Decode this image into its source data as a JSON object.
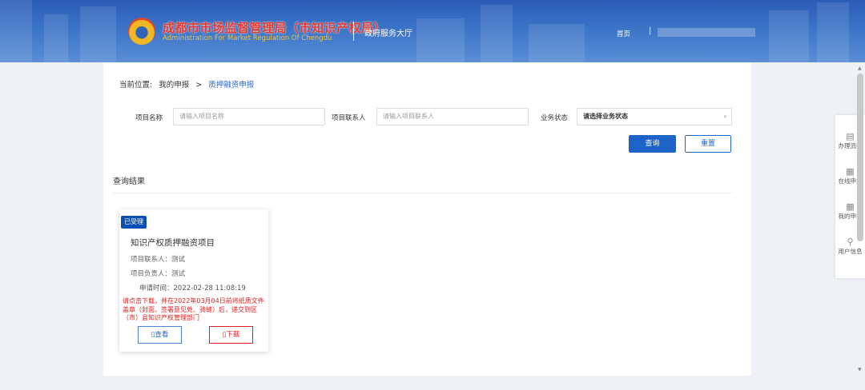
{
  "header": {
    "org_name_cn": "成都市市场监督管理局（市知识产权局）",
    "org_name_en": "Administration For Market Regulation Of Chengdu",
    "service_hall": "政府服务大厅",
    "home_link": "首页",
    "separator": "|"
  },
  "breadcrumb": {
    "prefix": "当前位置:",
    "parent": "我的申报",
    "arrow": ">",
    "current": "质押融资申报"
  },
  "filters": {
    "project_name_label": "项目名称",
    "project_name_placeholder": "请输入项目名称",
    "contact_label": "项目联系人",
    "contact_placeholder": "请输入项目联系人",
    "status_label": "业务状态",
    "status_value": "请选择业务状态"
  },
  "buttons": {
    "search": "查询",
    "reset": "重置"
  },
  "results": {
    "title": "查询结果",
    "card": {
      "badge": "已受理",
      "title": "知识产权质押融资项目",
      "contact": "项目联系人：测试",
      "owner": "项目负责人：测试",
      "apply_time": "申请时间：2022-02-28 11:08:19",
      "notice": "请点击下载，并在2022年03月04日前将纸质文件盖章（封面、签署意见处、骑缝）后，递交到区（市）县知识产权管理部门",
      "view_label": "查看",
      "download_label": "下载"
    }
  },
  "sidenav": {
    "items": [
      {
        "label": "办理流程",
        "icon": "document-icon"
      },
      {
        "label": "在线申报",
        "icon": "form-icon"
      },
      {
        "label": "我的申报",
        "icon": "edit-form-icon"
      },
      {
        "label": "用户信息",
        "icon": "user-icon"
      }
    ]
  },
  "colors": {
    "header_blue": "#2b5db6",
    "primary_blue": "#1e64c8",
    "badge_blue": "#0d4fb5",
    "notice_red": "#e02020",
    "org_name_red": "#e8382d",
    "org_name_en_yellow": "#f6c233"
  }
}
